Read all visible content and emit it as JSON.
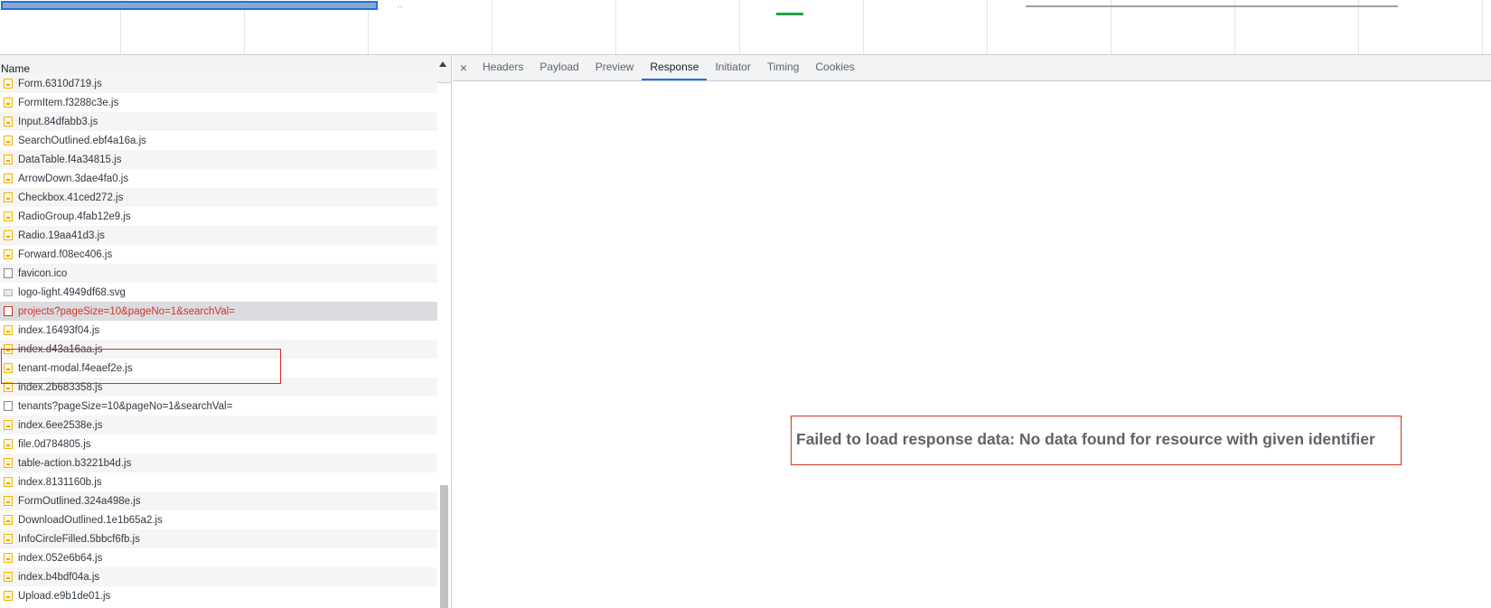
{
  "list": {
    "header_name": "Name",
    "rows": [
      {
        "label": "Form.6310d719.js",
        "type": "js"
      },
      {
        "label": "FormItem.f3288c3e.js",
        "type": "js"
      },
      {
        "label": "Input.84dfabb3.js",
        "type": "js"
      },
      {
        "label": "SearchOutlined.ebf4a16a.js",
        "type": "js"
      },
      {
        "label": "DataTable.f4a34815.js",
        "type": "js"
      },
      {
        "label": "ArrowDown.3dae4fa0.js",
        "type": "js"
      },
      {
        "label": "Checkbox.41ced272.js",
        "type": "js"
      },
      {
        "label": "RadioGroup.4fab12e9.js",
        "type": "js"
      },
      {
        "label": "Radio.19aa41d3.js",
        "type": "js"
      },
      {
        "label": "Forward.f08ec406.js",
        "type": "js"
      },
      {
        "label": "favicon.ico",
        "type": "doc"
      },
      {
        "label": "logo-light.4949df68.svg",
        "type": "img"
      },
      {
        "label": "projects?pageSize=10&pageNo=1&searchVal=",
        "type": "doc-red",
        "selected": true,
        "error": true
      },
      {
        "label": "index.16493f04.js",
        "type": "js"
      },
      {
        "label": "index.d43a16aa.js",
        "type": "js"
      },
      {
        "label": "tenant-modal.f4eaef2e.js",
        "type": "js"
      },
      {
        "label": "index.2b683358.js",
        "type": "js"
      },
      {
        "label": "tenants?pageSize=10&pageNo=1&searchVal=",
        "type": "doc"
      },
      {
        "label": "index.6ee2538e.js",
        "type": "js"
      },
      {
        "label": "file.0d784805.js",
        "type": "js"
      },
      {
        "label": "table-action.b3221b4d.js",
        "type": "js"
      },
      {
        "label": "index.8131160b.js",
        "type": "js"
      },
      {
        "label": "FormOutlined.324a498e.js",
        "type": "js"
      },
      {
        "label": "DownloadOutlined.1e1b65a2.js",
        "type": "js"
      },
      {
        "label": "InfoCircleFilled.5bbcf6fb.js",
        "type": "js"
      },
      {
        "label": "index.052e6b64.js",
        "type": "js"
      },
      {
        "label": "index.b4bdf04a.js",
        "type": "js"
      },
      {
        "label": "Upload.e9b1de01.js",
        "type": "js"
      }
    ]
  },
  "detail": {
    "close_symbol": "×",
    "tabs": [
      {
        "label": "Headers",
        "active": false
      },
      {
        "label": "Payload",
        "active": false
      },
      {
        "label": "Preview",
        "active": false
      },
      {
        "label": "Response",
        "active": true
      },
      {
        "label": "Initiator",
        "active": false
      },
      {
        "label": "Timing",
        "active": false
      },
      {
        "label": "Cookies",
        "active": false
      }
    ],
    "response_message": "Failed to load response data: No data found for resource with given identifier"
  },
  "colors": {
    "accent": "#1a73e8",
    "error": "#d93025",
    "js_icon": "#f4b400",
    "overview_green": "#1ea446"
  }
}
